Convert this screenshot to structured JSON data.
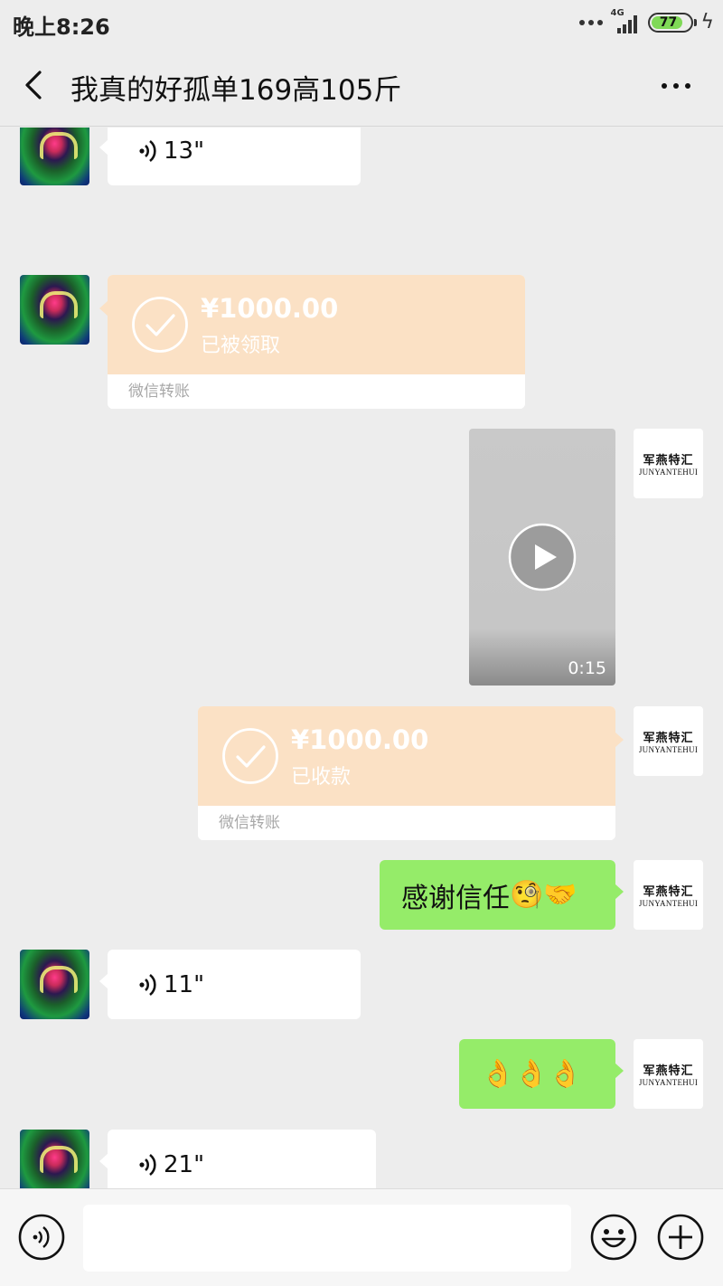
{
  "status_bar": {
    "time": "晚上8:26",
    "network": "4G",
    "battery": "77"
  },
  "header": {
    "title": "我真的好孤单169高105斤"
  },
  "messages": {
    "voice_1": {
      "duration": "13\""
    },
    "transfer_received": {
      "amount": "¥1000.00",
      "status": "已被领取",
      "footer": "微信转账"
    },
    "video": {
      "duration": "0:15"
    },
    "transfer_sent": {
      "amount": "¥1000.00",
      "status": "已收款",
      "footer": "微信转账"
    },
    "text_1": {
      "text": "感谢信任",
      "emoji": "🧐🤝"
    },
    "voice_2": {
      "duration": "11\""
    },
    "text_2": {
      "emoji": "👌👌👌"
    },
    "voice_3": {
      "duration": "21\""
    }
  },
  "my_avatar": {
    "logo_cn": "军燕特汇",
    "logo_en": "JUNYANTEHUI"
  },
  "icons": {
    "back": "chevron-left-icon",
    "more": "more-dots-icon",
    "voice": "voice-wave-icon",
    "check": "check-circle-icon",
    "play": "play-icon",
    "emoji": "smiley-icon",
    "plus": "plus-circle-icon"
  },
  "colors": {
    "background": "#ededed",
    "my_bubble": "#95ec69",
    "their_bubble": "#ffffff",
    "transfer": "#fbe1c5"
  }
}
